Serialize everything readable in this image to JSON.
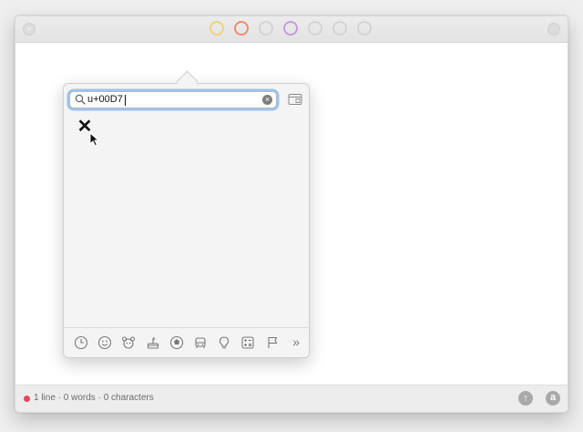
{
  "window": {
    "close_glyph": "×",
    "theme_dots": [
      {
        "name": "theme-yellow",
        "color": "#f2d27a"
      },
      {
        "name": "theme-orange",
        "color": "#f08c6c"
      },
      {
        "name": "theme-gray-1",
        "color": "#d4d4d4"
      },
      {
        "name": "theme-purple",
        "color": "#c89ae0"
      },
      {
        "name": "theme-gray-2",
        "color": "#d4d4d4"
      },
      {
        "name": "theme-gray-3",
        "color": "#d4d4d4"
      },
      {
        "name": "theme-gray-4",
        "color": "#d4d4d4"
      }
    ]
  },
  "status": {
    "text": "1 line · 0 words · 0 characters",
    "dot_color": "#e0485b",
    "share_glyph": "↑",
    "font_glyph": "a"
  },
  "character_viewer": {
    "search_value": "u+00D7",
    "clear_glyph": "×",
    "result_character": "✕",
    "categories": [
      {
        "name": "recent-icon"
      },
      {
        "name": "smileys-icon"
      },
      {
        "name": "animals-icon"
      },
      {
        "name": "food-icon"
      },
      {
        "name": "activity-icon"
      },
      {
        "name": "travel-icon"
      },
      {
        "name": "objects-icon"
      },
      {
        "name": "symbols-icon"
      },
      {
        "name": "flags-icon"
      }
    ],
    "more_glyph": "»"
  }
}
